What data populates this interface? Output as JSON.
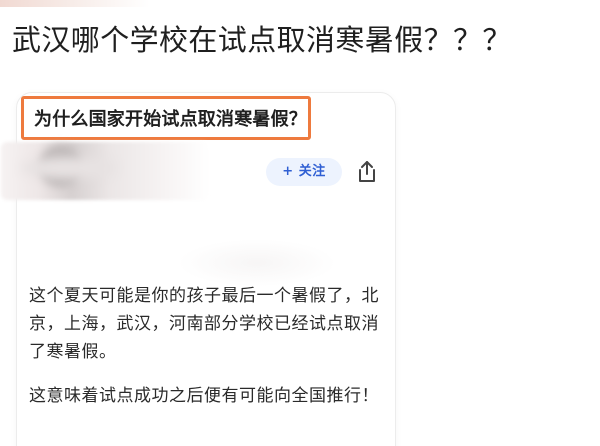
{
  "post": {
    "title": "武汉哪个学校在试点取消寒暑假？？？"
  },
  "card": {
    "question": "为什么国家开始试点取消寒暑假？",
    "follow_label": "+ 关注",
    "answer": [
      "这个夏天可能是你的孩子最后一个暑假了，北京，上海，武汉，河南部分学校已经试点取消了寒暑假。",
      "这意味着试点成功之后便有可能向全国推行！"
    ]
  },
  "icons": {
    "share": "share-icon"
  },
  "colors": {
    "highlight_border": "#ee7a3e",
    "follow_text": "#2f5fd3",
    "follow_bg": "#edf3fe"
  }
}
